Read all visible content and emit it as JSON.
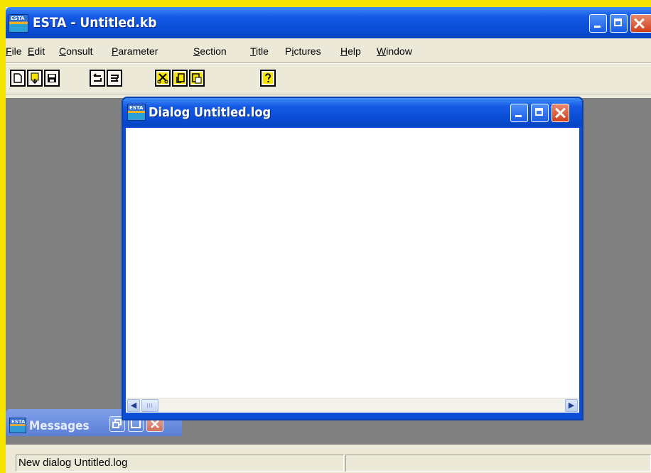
{
  "app": {
    "title": "ESTA - Untitled.kb",
    "icon_label": "ESTA"
  },
  "menu": [
    {
      "underline": "F",
      "rest": "ile"
    },
    {
      "underline": "E",
      "rest": "dit"
    },
    {
      "underline": "C",
      "rest": "onsult"
    },
    {
      "underline": "P",
      "rest": "arameter"
    },
    {
      "underline": "S",
      "rest": "ection"
    },
    {
      "underline": "T",
      "rest": "itle"
    },
    {
      "pre": "P",
      "underline": "i",
      "rest": "ctures"
    },
    {
      "underline": "H",
      "rest": "elp"
    },
    {
      "underline": "W",
      "rest": "indow"
    }
  ],
  "toolbar": {
    "icons": [
      "new-file-icon",
      "open-file-icon",
      "save-icon",
      "undo-icon",
      "redo-icon",
      "cut-icon",
      "copy-icon",
      "paste-icon",
      "help-icon"
    ],
    "help_glyph": "?"
  },
  "dialog": {
    "title": "Dialog Untitled.log"
  },
  "messages": {
    "title": "Messages"
  },
  "status": {
    "text": "New dialog  Untitled.log",
    "right": ""
  },
  "colors": {
    "background": "#f5e300",
    "titlebar": "#0a4ed6",
    "mdi_background": "#808080",
    "toolbar_icon_fill": "#f5e300"
  }
}
